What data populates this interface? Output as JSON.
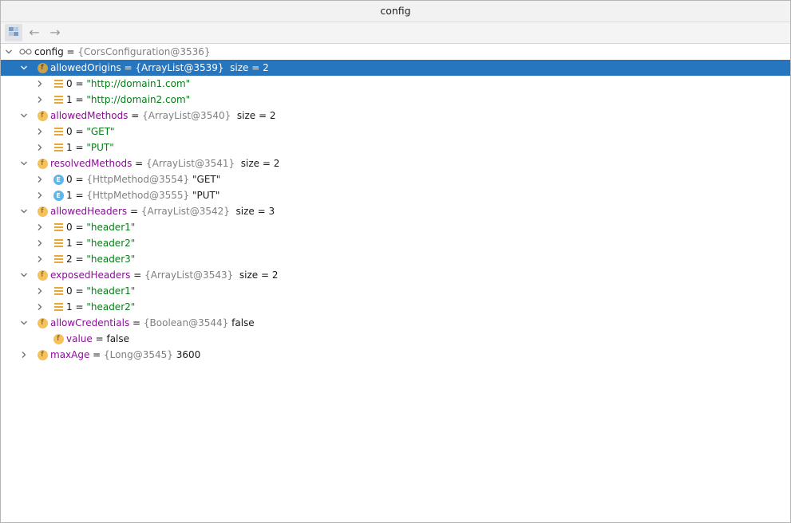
{
  "window": {
    "title": "config"
  },
  "toolbar": {
    "buttons": [
      {
        "name": "layout-icon"
      },
      {
        "name": "back-arrow-icon",
        "glyph": "←"
      },
      {
        "name": "forward-arrow-icon",
        "glyph": "→"
      }
    ]
  },
  "tree": {
    "root": {
      "name": "config",
      "eq": " = ",
      "type": "{CorsConfiguration@3536}"
    },
    "fields": [
      {
        "name": "allowedOrigins",
        "eq": " = ",
        "type": "{ArrayList@3539}",
        "size": "  size = 2",
        "items": [
          {
            "index": "0",
            "eq": " = ",
            "value": "\"http://domain1.com\""
          },
          {
            "index": "1",
            "eq": " = ",
            "value": "\"http://domain2.com\""
          }
        ]
      },
      {
        "name": "allowedMethods",
        "eq": " = ",
        "type": "{ArrayList@3540}",
        "size": "  size = 2",
        "items": [
          {
            "index": "0",
            "eq": " = ",
            "value": "\"GET\""
          },
          {
            "index": "1",
            "eq": " = ",
            "value": "\"PUT\""
          }
        ]
      },
      {
        "name": "resolvedMethods",
        "eq": " = ",
        "type": "{ArrayList@3541}",
        "size": "  size = 2",
        "items": [
          {
            "index": "0",
            "eq": " = ",
            "type": "{HttpMethod@3554}",
            "value": " \"GET\""
          },
          {
            "index": "1",
            "eq": " = ",
            "type": "{HttpMethod@3555}",
            "value": " \"PUT\""
          }
        ]
      },
      {
        "name": "allowedHeaders",
        "eq": " = ",
        "type": "{ArrayList@3542}",
        "size": "  size = 3",
        "items": [
          {
            "index": "0",
            "eq": " = ",
            "value": "\"header1\""
          },
          {
            "index": "1",
            "eq": " = ",
            "value": "\"header2\""
          },
          {
            "index": "2",
            "eq": " = ",
            "value": "\"header3\""
          }
        ]
      },
      {
        "name": "exposedHeaders",
        "eq": " = ",
        "type": "{ArrayList@3543}",
        "size": "  size = 2",
        "items": [
          {
            "index": "0",
            "eq": " = ",
            "value": "\"header1\""
          },
          {
            "index": "1",
            "eq": " = ",
            "value": "\"header2\""
          }
        ]
      },
      {
        "name": "allowCredentials",
        "eq": " = ",
        "type": "{Boolean@3544}",
        "value": " false",
        "child": {
          "name": "value",
          "eq": " = ",
          "value": "false"
        }
      },
      {
        "name": "maxAge",
        "eq": " = ",
        "type": "{Long@3545}",
        "value": " 3600"
      }
    ]
  },
  "badges": {
    "field": "f",
    "enum": "E"
  },
  "colors": {
    "selection": "#2675bf",
    "string": "#067d17",
    "field_name": "#871094",
    "type": "#808080"
  }
}
